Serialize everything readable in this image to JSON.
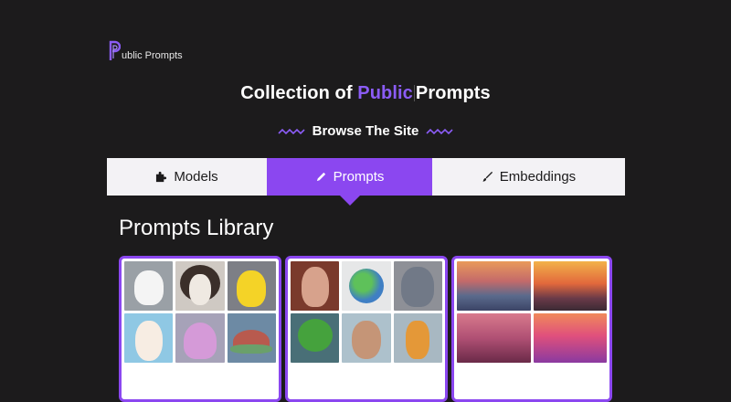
{
  "brand": {
    "logo_text": "ublic Prompts",
    "accent": "#8b5cf6"
  },
  "headline": {
    "part1": "Collection of ",
    "accent": "Public",
    "part2": "Prompts"
  },
  "browse": {
    "label": "Browse The Site"
  },
  "tabs": [
    {
      "label": "Models",
      "icon": "puzzle-icon",
      "active": false
    },
    {
      "label": "Prompts",
      "icon": "pen-icon",
      "active": true
    },
    {
      "label": "Embeddings",
      "icon": "brush-icon",
      "active": false
    }
  ],
  "library": {
    "title": "Prompts Library"
  },
  "cards": [
    {
      "name": "plush-toys",
      "tiles": [
        "white-cat-plush",
        "lion-plush",
        "pikachu-plush",
        "bunny-plush",
        "octopus-plush",
        "turtle-plush"
      ]
    },
    {
      "name": "3d-characters",
      "tiles": [
        "girl-portrait",
        "earth-globe",
        "totoro-figure",
        "frog-character",
        "man-caricature",
        "giraffe-toy"
      ]
    },
    {
      "name": "landscapes",
      "tiles": [
        "mountain-sunset",
        "city-sunset",
        "desert-mountains",
        "pink-hills"
      ]
    }
  ]
}
